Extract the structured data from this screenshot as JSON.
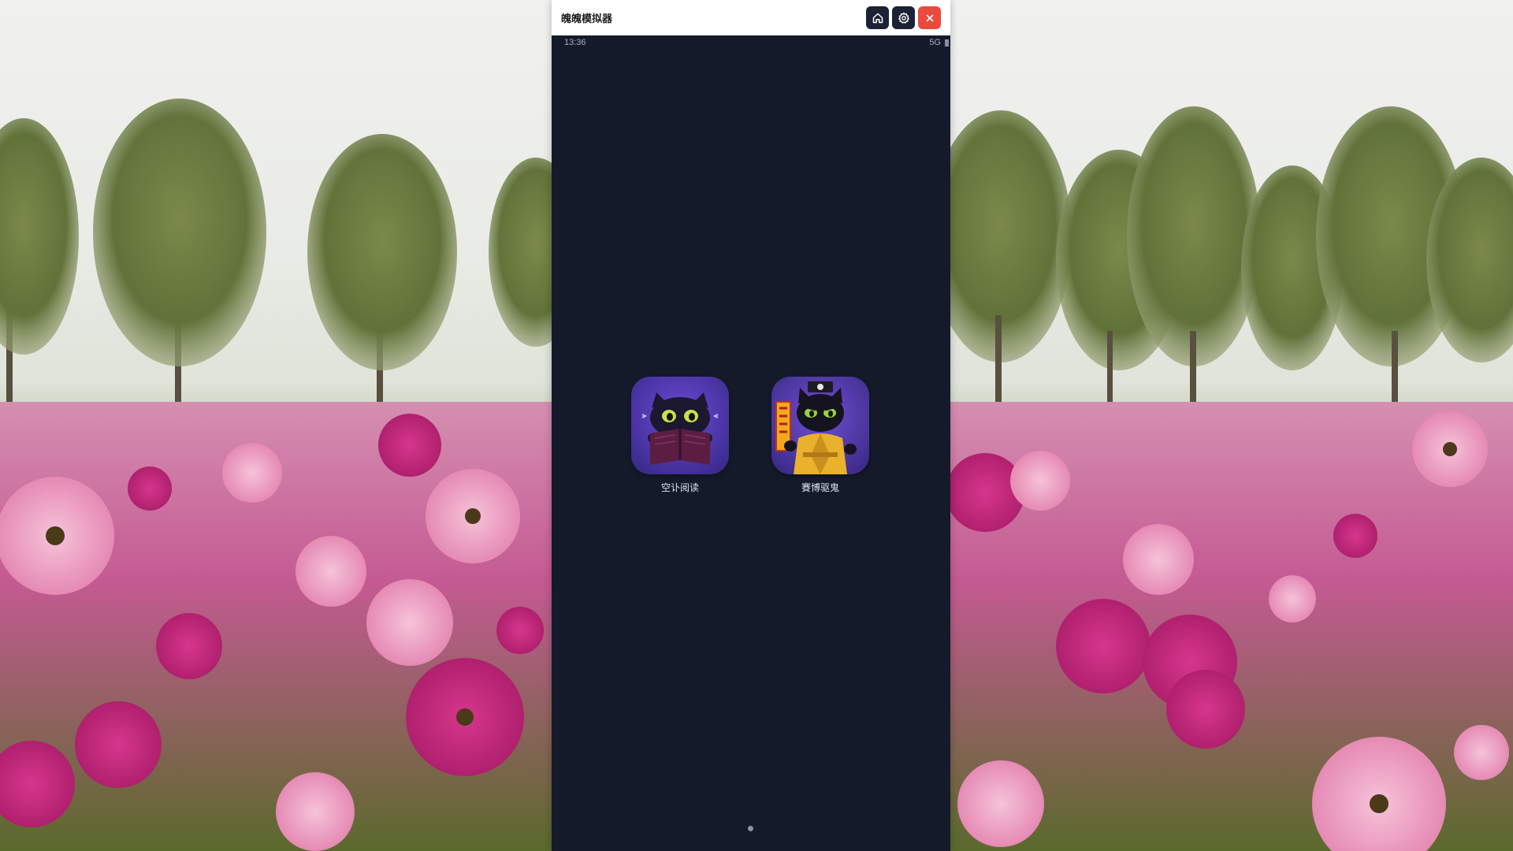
{
  "window": {
    "title": "魄魄模拟器",
    "buttons": [
      {
        "name": "home",
        "icon": "home-icon"
      },
      {
        "name": "settings",
        "icon": "gear-icon"
      },
      {
        "name": "close",
        "icon": "close-icon"
      }
    ],
    "colors": {
      "dark_button": "#1b2233",
      "close_button": "#e94a3c",
      "screen_bg": "#151a2b"
    }
  },
  "status_bar": {
    "time": "13:36",
    "network": "5G",
    "battery_icon": "battery-icon"
  },
  "home_screen": {
    "apps": [
      {
        "label": "空讣阅读",
        "icon": "cat-reading-book-icon"
      },
      {
        "label": "賽博驱鬼",
        "icon": "cat-taoist-exorcist-icon"
      }
    ],
    "page_indicator": {
      "pages": 1,
      "current": 1
    }
  },
  "wallpaper": {
    "subject": "cosmos-flower-field-wallpaper"
  }
}
